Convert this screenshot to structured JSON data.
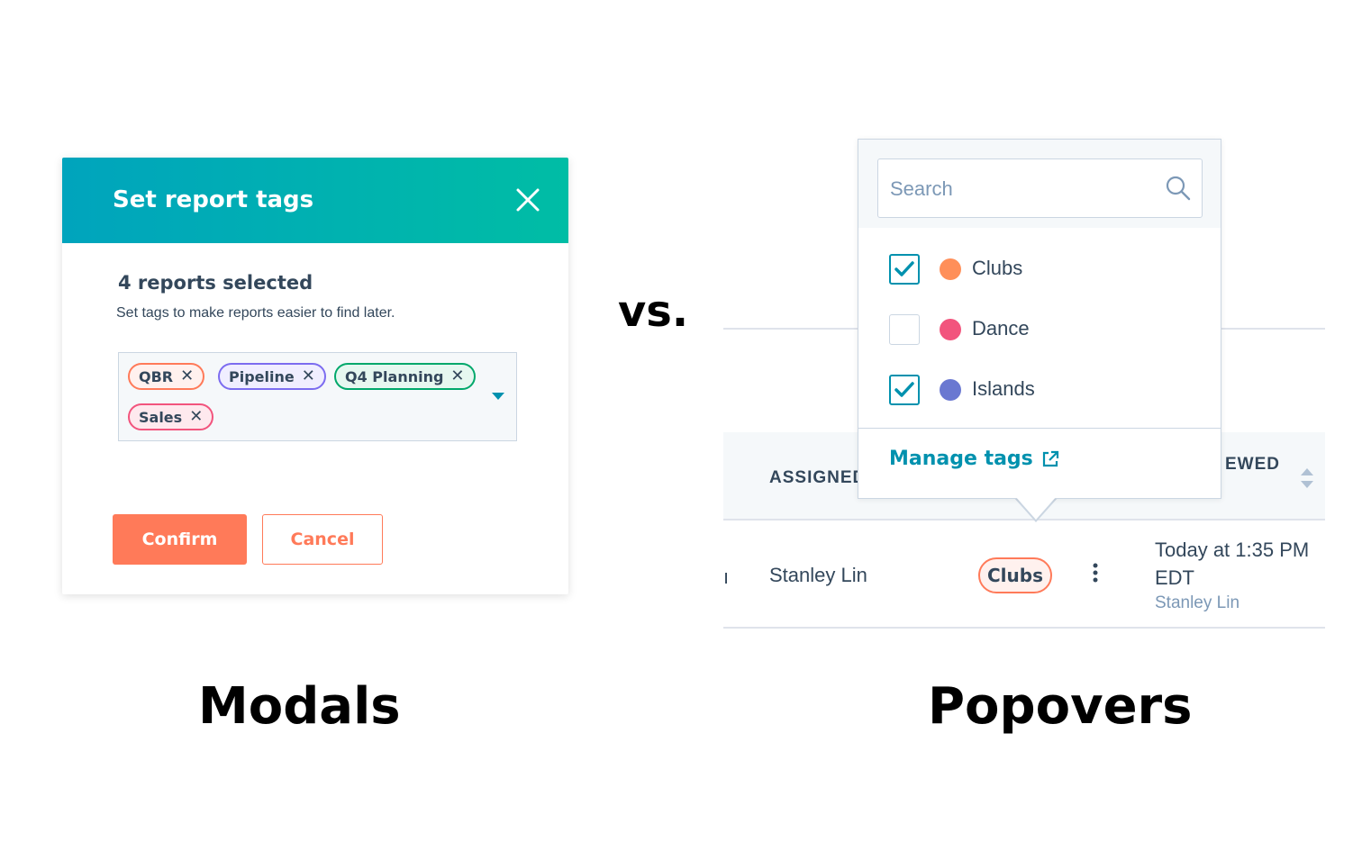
{
  "modal": {
    "title": "Set report tags",
    "reports_count": "4 reports selected",
    "help_text": "Set tags to make reports easier to find later.",
    "tags": [
      {
        "label": "QBR",
        "color": "#ff7a59"
      },
      {
        "label": "Pipeline",
        "color": "#7c6cf0"
      },
      {
        "label": "Q4 Planning",
        "color": "#00a86b"
      },
      {
        "label": "Sales",
        "color": "#f2547d"
      }
    ],
    "confirm_label": "Confirm",
    "cancel_label": "Cancel"
  },
  "separator": "vs.",
  "captions": {
    "left": "Modals",
    "right": "Popovers"
  },
  "popover": {
    "search_placeholder": "Search",
    "options": [
      {
        "label": "Clubs",
        "checked": true,
        "color": "#ff8f59"
      },
      {
        "label": "Dance",
        "checked": false,
        "color": "#f2547d"
      },
      {
        "label": "Islands",
        "checked": true,
        "color": "#6a78d1"
      }
    ],
    "manage_label": "Manage tags"
  },
  "table": {
    "col_assigned": "ASSIGNED",
    "col_viewed": "EWED",
    "row": {
      "assignee": "Stanley Lin",
      "tag": "Clubs",
      "viewed_time_line1": "Today at 1:35 PM",
      "viewed_time_line2": "EDT",
      "viewed_by": "Stanley Lin"
    }
  },
  "colors": {
    "accent": "#0091ae",
    "primary_button": "#ff7a59",
    "header_gradient_start": "#00a4bd",
    "header_gradient_end": "#00bda5"
  }
}
